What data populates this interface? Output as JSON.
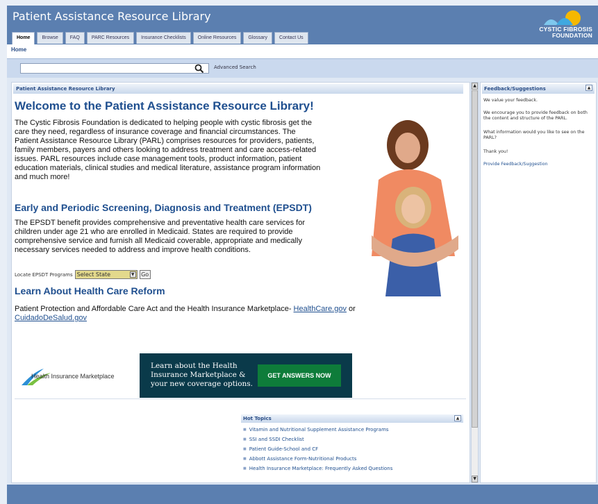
{
  "header": {
    "title": "Patient Assistance Resource Library",
    "logo_text_line1": "CYSTIC FIBROSIS",
    "logo_text_line2": "FOUNDATION"
  },
  "tabs": [
    {
      "label": "Home",
      "active": true
    },
    {
      "label": "Browse"
    },
    {
      "label": "FAQ"
    },
    {
      "label": "PARC Resources"
    },
    {
      "label": "Insurance Checklists"
    },
    {
      "label": "Online Resources"
    },
    {
      "label": "Glossary"
    },
    {
      "label": "Contact Us"
    }
  ],
  "breadcrumb": "Home",
  "search": {
    "placeholder": "",
    "advanced_label": "Advanced Search"
  },
  "content": {
    "panel_title": "Patient Assistance Resource Library",
    "heading": "Welcome to the Patient Assistance Resource Library!",
    "intro_lines": [
      "The Cystic Fibrosis Foundation is dedicated to helping people with cystic fibrosis get the",
      "care they need, regardless of insurance coverage and financial circumstances.  The",
      "Patient Assistance Resource Library (PARL) comprises resources for providers, patients,",
      "family members, payers and others looking to address treatment and care access-related",
      "issues.  PARL resources include case management tools, product information, patient",
      "education materials, clinical studies and medical literature, assistance program information",
      "and much more!"
    ],
    "epsdt_heading": "Early and Periodic Screening, Diagnosis and Treatment (EPSDT)",
    "epsdt_lines": [
      "The EPSDT benefit provides comprehensive and preventative health care services for",
      "children under age 21 who are enrolled in Medicaid.  States are required to provide",
      "comprehensive service and furnish all Medicaid coverable, appropriate and medically",
      "necessary services needed to address and improve health conditions."
    ],
    "locate_label": "Locate EPSDT Programs",
    "state_select_value": "Select State",
    "go_label": "Go",
    "reform_heading": "Learn About Health Care Reform",
    "reform_text": "Patient Protection and Affordable Care Act and the Health Insurance Marketplace-",
    "reform_link1": "HealthCare.gov",
    "reform_or": "or",
    "reform_link2": "CuidadoDeSalud.gov",
    "banner": {
      "logo_text": "Health Insurance Marketplace",
      "line1": "Learn about the Health",
      "line2": "Insurance Marketplace &",
      "line3": "your new coverage options.",
      "button": "GET ANSWERS NOW"
    }
  },
  "hot_topics": {
    "title": "Hot Topics",
    "items": [
      "Vitamin and Nutritional Supplement Assistance Programs",
      "SSI and SSDI Checklist",
      "Patient Guide-School and CF",
      "Abbott Assistance Form-Nutritional Products",
      "Health Insurance Marketplace: Frequently Asked Questions"
    ]
  },
  "sidebar": {
    "title": "Feedback/Suggestions",
    "p1": "We value your feedback.",
    "p2": "We encourage you to provide feedback on both the content and structure of the PARL.",
    "p3": "What information would you like to see on the PARL?",
    "p4": "Thank you!",
    "link": "Provide Feedback/Suggestion"
  }
}
